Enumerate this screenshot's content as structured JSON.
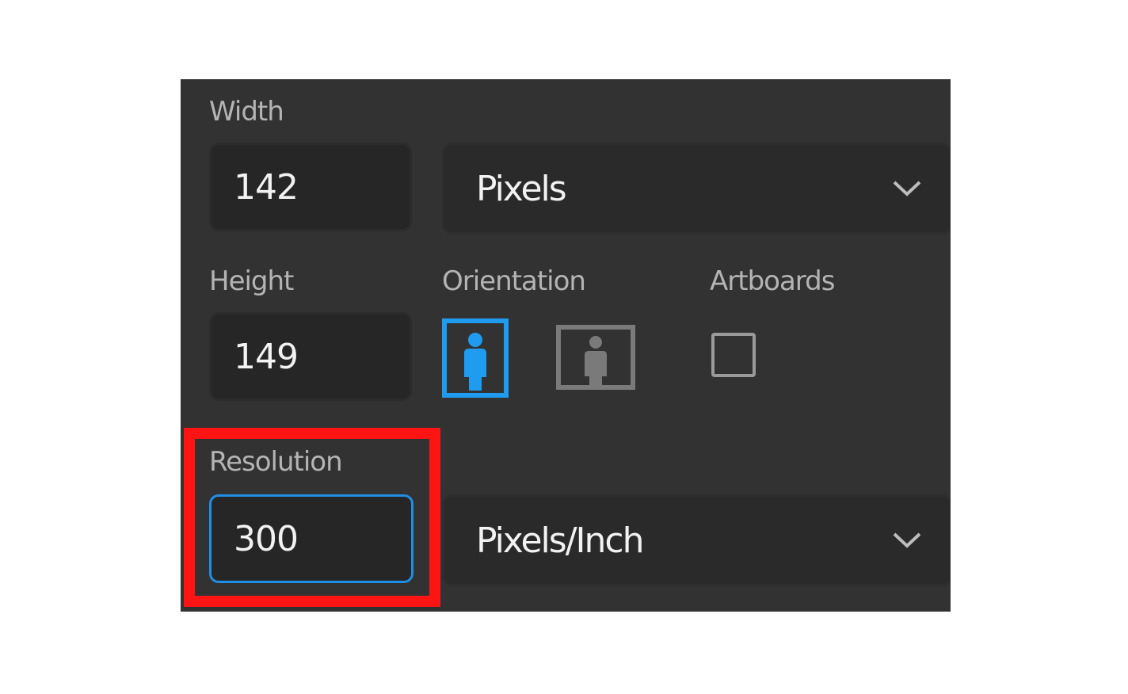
{
  "width": {
    "label": "Width",
    "value": "142"
  },
  "width_unit": {
    "value": "Pixels"
  },
  "height": {
    "label": "Height",
    "value": "149"
  },
  "orientation": {
    "label": "Orientation",
    "selected": "portrait"
  },
  "artboards": {
    "label": "Artboards",
    "checked": false
  },
  "resolution": {
    "label": "Resolution",
    "value": "300"
  },
  "resolution_unit": {
    "value": "Pixels/Inch"
  },
  "colors": {
    "panel": "#323232",
    "accent": "#1f8fe6",
    "highlight": "#ff1414"
  }
}
